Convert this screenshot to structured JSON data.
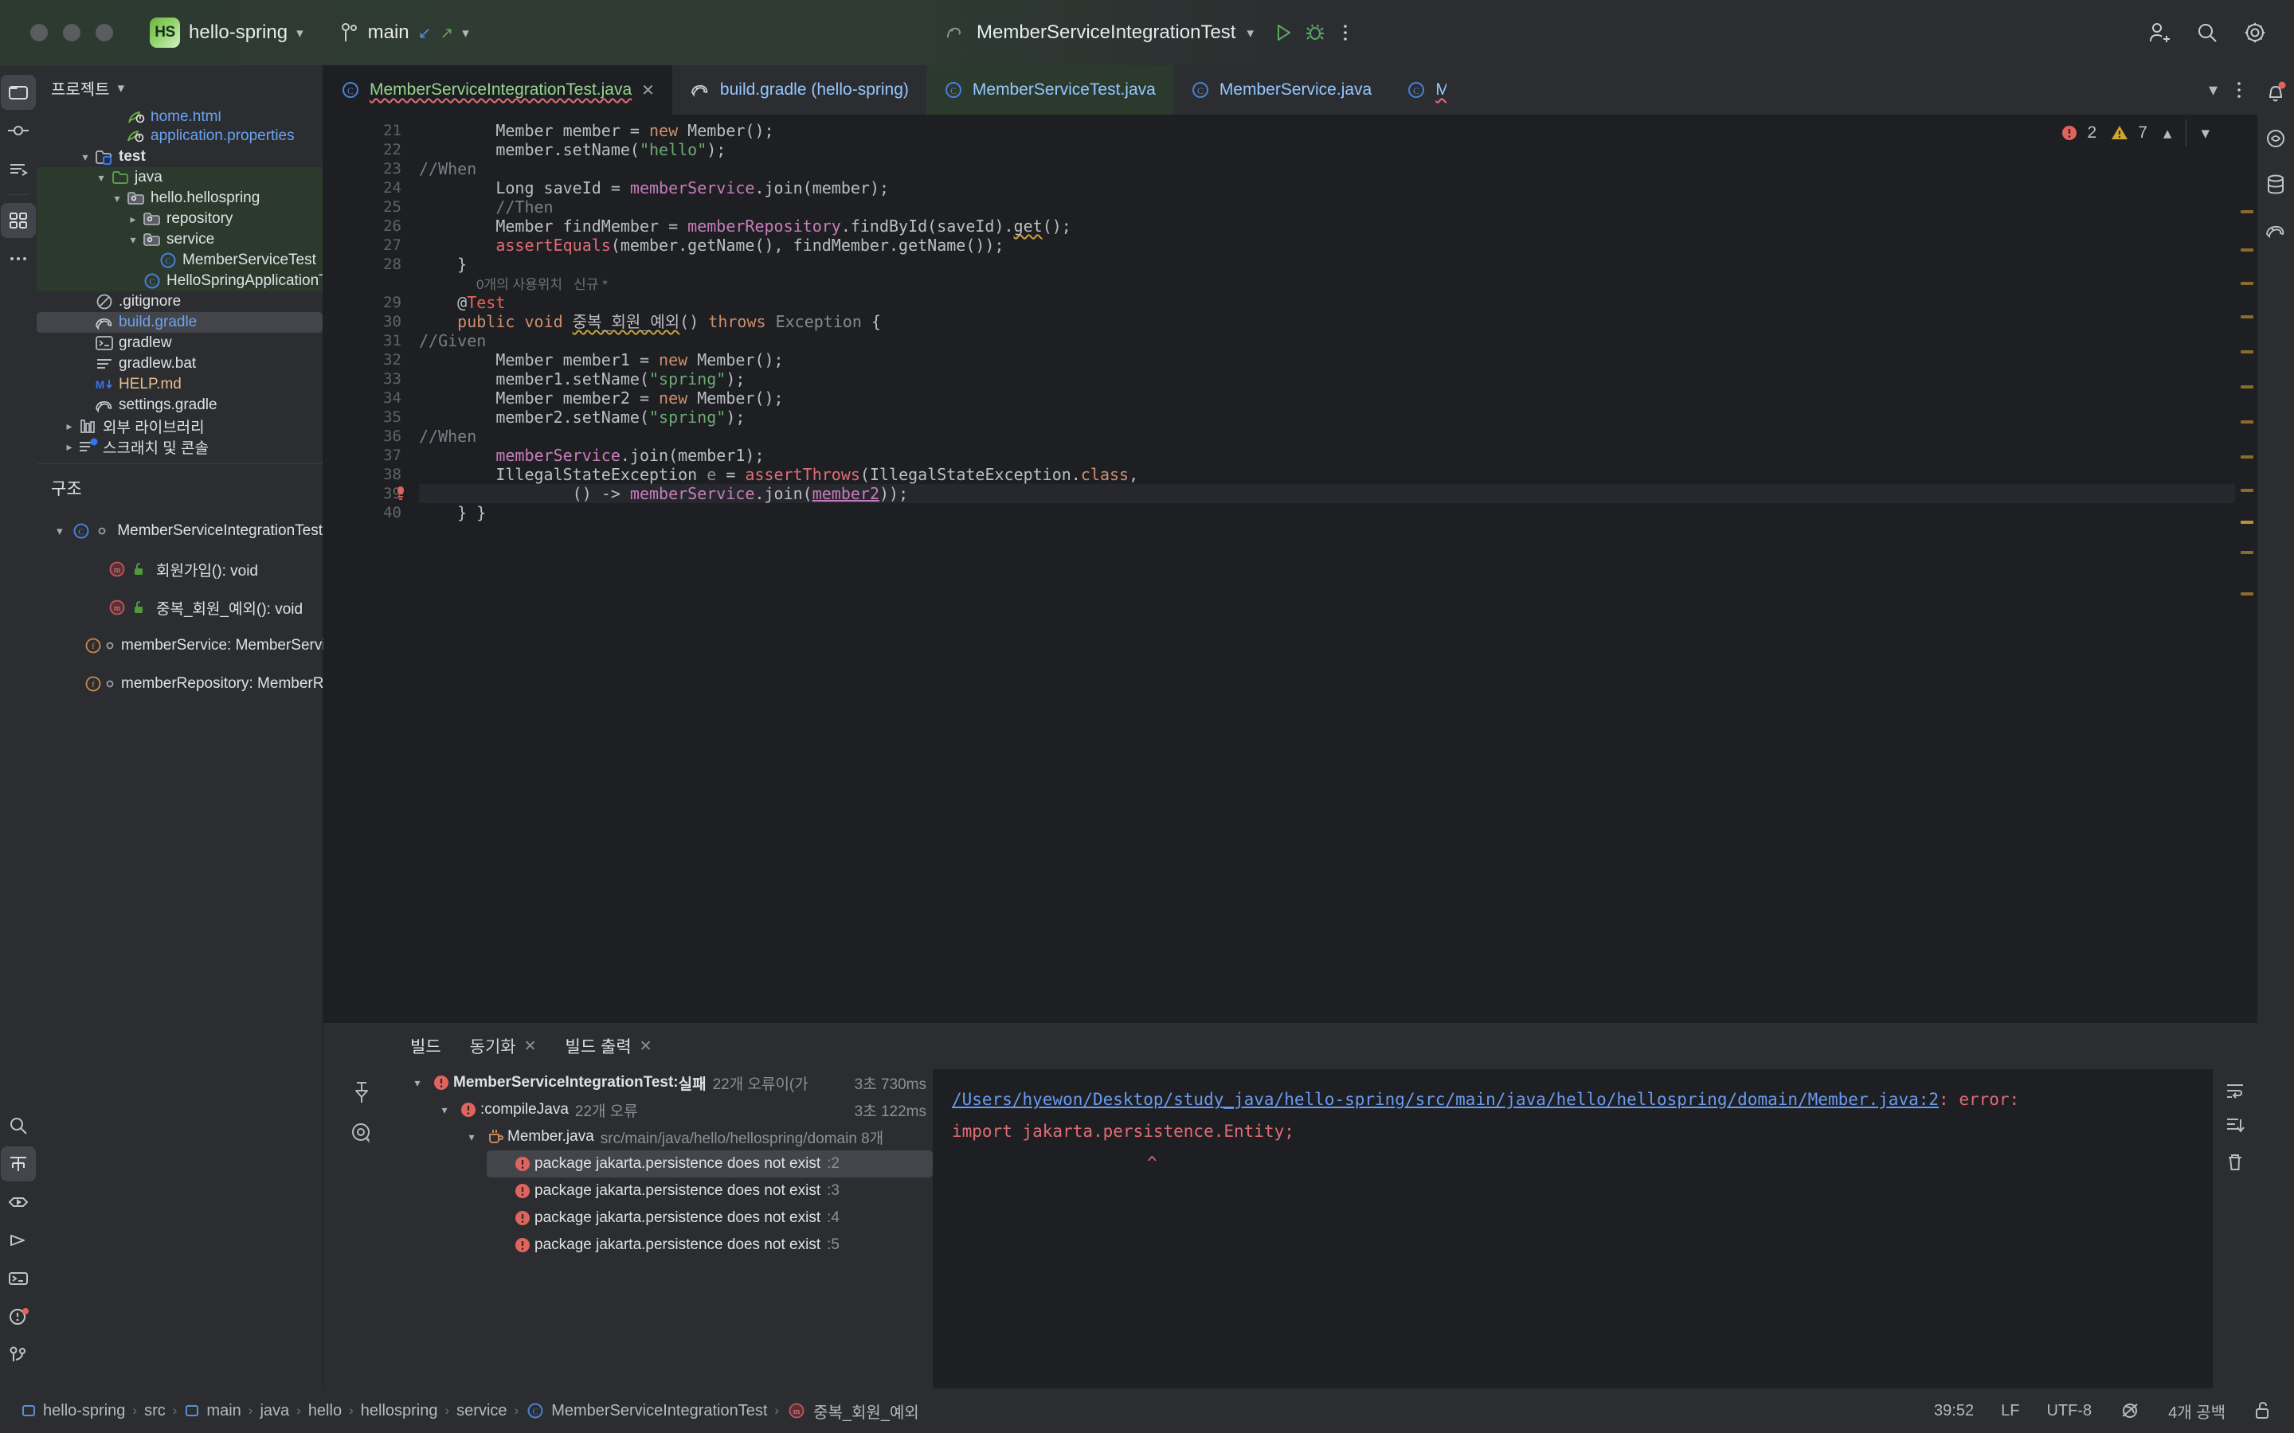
{
  "titlebar": {
    "project_badge": "HS",
    "project_name": "hello-spring",
    "branch": "main",
    "run_config": "MemberServiceIntegrationTest",
    "icons": {
      "run": "run-icon",
      "debug": "debug-icon",
      "more": "more-options-icon",
      "add_user": "add-user-icon",
      "search": "search-icon",
      "settings": "gear-icon"
    }
  },
  "left_rail": [
    {
      "name": "project-tool-icon",
      "active": true
    },
    {
      "name": "commit-tool-icon",
      "active": false
    },
    {
      "name": "pull-requests-icon",
      "active": false
    },
    {
      "name": "structure-tool-icon",
      "active": true
    },
    {
      "name": "more-tool-windows-icon",
      "active": false
    }
  ],
  "left_rail_bottom": [
    {
      "name": "search-everywhere-icon"
    },
    {
      "name": "structure-icon",
      "active": true
    },
    {
      "name": "run-tool-icon"
    },
    {
      "name": "debug-tool-icon"
    },
    {
      "name": "terminal-icon"
    },
    {
      "name": "problems-icon",
      "badge": true
    },
    {
      "name": "version-control-icon"
    }
  ],
  "right_rail": [
    {
      "name": "notifications-icon",
      "badge": true
    },
    {
      "name": "ai-assistant-icon"
    },
    {
      "name": "database-icon"
    },
    {
      "name": "gradle-icon"
    }
  ],
  "project_panel": {
    "title": "프로젝트",
    "tree": [
      {
        "indent": 4,
        "arrow": "",
        "icon": "spring-leaf-icon",
        "label": "home.html",
        "color": "blue",
        "clipped": true,
        "bg": "none"
      },
      {
        "indent": 4,
        "arrow": "",
        "icon": "spring-properties-icon",
        "label": "application.properties",
        "color": "blue",
        "bg": "none"
      },
      {
        "indent": 2,
        "arrow": "v",
        "icon": "test-folder-icon",
        "label": "test",
        "bold": true,
        "bg": "none"
      },
      {
        "indent": 3,
        "arrow": "v",
        "icon": "source-folder-icon",
        "label": "java",
        "bg": "green"
      },
      {
        "indent": 4,
        "arrow": "v",
        "icon": "package-icon",
        "label": "hello.hellospring",
        "bg": "green"
      },
      {
        "indent": 5,
        "arrow": ">",
        "icon": "package-icon",
        "label": "repository",
        "bg": "green"
      },
      {
        "indent": 5,
        "arrow": "v",
        "icon": "package-icon",
        "label": "service",
        "bg": "green"
      },
      {
        "indent": 6,
        "arrow": "",
        "icon": "class-icon",
        "label": "MemberServiceTest",
        "bg": "green"
      },
      {
        "indent": 5,
        "arrow": "",
        "icon": "class-icon",
        "label": "HelloSpringApplicationTests",
        "bg": "green"
      },
      {
        "indent": 2,
        "arrow": "",
        "icon": "gitignore-icon",
        "label": ".gitignore",
        "bg": "none"
      },
      {
        "indent": 2,
        "arrow": "",
        "icon": "gradle-icon",
        "label": "build.gradle",
        "color": "blue",
        "selected": true,
        "bg": "none"
      },
      {
        "indent": 2,
        "arrow": "",
        "icon": "shell-icon",
        "label": "gradlew",
        "bg": "none"
      },
      {
        "indent": 2,
        "arrow": "",
        "icon": "text-file-icon",
        "label": "gradlew.bat",
        "bg": "none"
      },
      {
        "indent": 2,
        "arrow": "",
        "icon": "markdown-icon",
        "label": "HELP.md",
        "color": "orange",
        "bg": "none"
      },
      {
        "indent": 2,
        "arrow": "",
        "icon": "gradle-icon",
        "label": "settings.gradle",
        "bg": "none"
      },
      {
        "indent": 1,
        "arrow": ">",
        "icon": "library-icon",
        "label": "외부 라이브러리",
        "bg": "none"
      },
      {
        "indent": 1,
        "arrow": ">",
        "icon": "scratches-icon",
        "label": "스크래치 및 콘솔",
        "bg": "none"
      }
    ]
  },
  "structure_panel": {
    "title": "구조",
    "items": [
      {
        "indent": 1,
        "arrow": "v",
        "icon": "class-icon",
        "mod": "package-private-icon",
        "label": "MemberServiceIntegrationTest"
      },
      {
        "indent": 2,
        "arrow": "",
        "icon": "method-icon",
        "mod": "public-lock-icon",
        "label": "회원가입(): void"
      },
      {
        "indent": 2,
        "arrow": "",
        "icon": "method-icon",
        "mod": "public-lock-icon",
        "label": "중복_회원_예외(): void"
      },
      {
        "indent": 2,
        "arrow": "",
        "icon": "field-icon",
        "mod": "package-private-icon",
        "label": "memberService: MemberService"
      },
      {
        "indent": 2,
        "arrow": "",
        "icon": "field-icon",
        "mod": "package-private-icon",
        "label": "memberRepository: MemberRepository"
      }
    ]
  },
  "editor_tabs": [
    {
      "label": "MemberServiceIntegrationTest.java",
      "icon": "class-icon",
      "active": true,
      "closable": true,
      "error": true
    },
    {
      "label": "build.gradle (hello-spring)",
      "icon": "gradle-icon",
      "active": false,
      "closable": false
    },
    {
      "label": "MemberServiceTest.java",
      "icon": "class-icon",
      "active": false,
      "highlight": true
    },
    {
      "label": "MemberService.java",
      "icon": "class-icon",
      "active": false
    },
    {
      "label": "M",
      "icon": "class-icon",
      "active": false,
      "truncated": true,
      "error": true
    }
  ],
  "editor_tabs_right_icons": [
    "chevron-down-icon",
    "more-options-icon"
  ],
  "inspections": {
    "errors": "2",
    "warnings": "7",
    "up": "prev-problem-icon",
    "down": "next-problem-icon",
    "collapse": "chevron-up-icon",
    "expand": "chevron-down-icon"
  },
  "code": {
    "first_line": 21,
    "lines": [
      {
        "n": 21,
        "tokens": [
          {
            "t": "        Member member = ",
            "c": "typ"
          },
          {
            "t": "new",
            "c": "kw"
          },
          {
            "t": " Member();",
            "c": "typ"
          }
        ]
      },
      {
        "n": 22,
        "tokens": [
          {
            "t": "        member.setName(",
            "c": "typ"
          },
          {
            "t": "\"hello\"",
            "c": "str"
          },
          {
            "t": ");",
            "c": "typ"
          }
        ]
      },
      {
        "n": 23,
        "tokens": [
          {
            "t": "//When",
            "c": "cmt"
          }
        ],
        "nopad": true
      },
      {
        "n": 24,
        "tokens": [
          {
            "t": "        Long saveId = ",
            "c": "typ"
          },
          {
            "t": "memberService",
            "c": "fld"
          },
          {
            "t": ".join(member);",
            "c": "typ"
          }
        ]
      },
      {
        "n": 25,
        "tokens": [
          {
            "t": "        //Then",
            "c": "cmt"
          }
        ]
      },
      {
        "n": 26,
        "tokens": [
          {
            "t": "        Member findMember = ",
            "c": "typ"
          },
          {
            "t": "memberRepository",
            "c": "fld"
          },
          {
            "t": ".findById(saveId).",
            "c": "typ"
          },
          {
            "t": "get",
            "c": "wavy"
          },
          {
            "t": "();",
            "c": "typ"
          }
        ]
      },
      {
        "n": 27,
        "tokens": [
          {
            "t": "        ",
            "c": "typ"
          },
          {
            "t": "assertEquals",
            "c": "stat"
          },
          {
            "t": "(member.getName(), findMember.getName());",
            "c": "typ"
          }
        ]
      },
      {
        "n": 28,
        "tokens": [
          {
            "t": "    }",
            "c": "typ"
          }
        ]
      },
      {
        "n": null,
        "usage": "0개의 사용위치   신규 *"
      },
      {
        "n": 29,
        "tokens": [
          {
            "t": "    @",
            "c": "typ"
          },
          {
            "t": "Test",
            "c": "annot"
          }
        ]
      },
      {
        "n": 30,
        "tokens": [
          {
            "t": "    ",
            "c": "typ"
          },
          {
            "t": "public void",
            "c": "kw"
          },
          {
            "t": " ",
            "c": "typ"
          },
          {
            "t": "중복_회원_예외",
            "c": "wavy"
          },
          {
            "t": "() ",
            "c": "typ"
          },
          {
            "t": "throws",
            "c": "kw"
          },
          {
            "t": " ",
            "c": "typ"
          },
          {
            "t": "Exception",
            "c": "dim"
          },
          {
            "t": " {",
            "c": "typ"
          }
        ]
      },
      {
        "n": 31,
        "tokens": [
          {
            "t": "//Given",
            "c": "cmt"
          }
        ],
        "nopad": true
      },
      {
        "n": 32,
        "tokens": [
          {
            "t": "        Member member1 = ",
            "c": "typ"
          },
          {
            "t": "new",
            "c": "kw"
          },
          {
            "t": " Member();",
            "c": "typ"
          }
        ]
      },
      {
        "n": 33,
        "tokens": [
          {
            "t": "        member1.setName(",
            "c": "typ"
          },
          {
            "t": "\"spring\"",
            "c": "str"
          },
          {
            "t": ");",
            "c": "typ"
          }
        ]
      },
      {
        "n": 34,
        "tokens": [
          {
            "t": "        Member member2 = ",
            "c": "typ"
          },
          {
            "t": "new",
            "c": "kw"
          },
          {
            "t": " Member();",
            "c": "typ"
          }
        ]
      },
      {
        "n": 35,
        "tokens": [
          {
            "t": "        member2.setName(",
            "c": "typ"
          },
          {
            "t": "\"spring\"",
            "c": "str"
          },
          {
            "t": ");",
            "c": "typ"
          }
        ]
      },
      {
        "n": 36,
        "tokens": [
          {
            "t": "//When",
            "c": "cmt"
          }
        ],
        "nopad": true
      },
      {
        "n": 37,
        "tokens": [
          {
            "t": "        ",
            "c": "typ"
          },
          {
            "t": "memberService",
            "c": "fld"
          },
          {
            "t": ".join(member1);",
            "c": "typ"
          }
        ]
      },
      {
        "n": 38,
        "tokens": [
          {
            "t": "        IllegalStateException ",
            "c": "typ"
          },
          {
            "t": "e",
            "c": "dim"
          },
          {
            "t": " = ",
            "c": "typ"
          },
          {
            "t": "assertThrows",
            "c": "stat"
          },
          {
            "t": "(IllegalStateException.",
            "c": "typ"
          },
          {
            "t": "class",
            "c": "kw"
          },
          {
            "t": ",",
            "c": "typ"
          }
        ]
      },
      {
        "n": 39,
        "tokens": [
          {
            "t": "                () -> ",
            "c": "typ"
          },
          {
            "t": "memberService",
            "c": "fld"
          },
          {
            "t": ".join(",
            "c": "typ"
          },
          {
            "t": "member2",
            "c": "fldu"
          },
          {
            "t": "));",
            "c": "typ"
          }
        ],
        "hl": true,
        "err_marker": true
      },
      {
        "n": 40,
        "tokens": [
          {
            "t": "    } }",
            "c": "typ"
          }
        ]
      }
    ]
  },
  "build_panel": {
    "tabs": [
      {
        "label": "빌드",
        "closable": false,
        "active": false
      },
      {
        "label": "동기화",
        "closable": true,
        "active": false
      },
      {
        "label": "빌드 출력",
        "closable": true,
        "active": true
      }
    ],
    "rail_icons": [
      "pin-icon",
      "target-icon"
    ],
    "tree": [
      {
        "indent": 0,
        "arrow": "v",
        "icon": "error-icon",
        "label": "MemberServiceIntegrationTest:",
        "bold": true,
        "suffix": " 실패",
        "detail": "22개 오류이(가",
        "time": "3초 730ms"
      },
      {
        "indent": 1,
        "arrow": "v",
        "icon": "error-icon",
        "label": ":compileJava",
        "detail": "22개 오류",
        "time": "3초 122ms"
      },
      {
        "indent": 2,
        "arrow": "v",
        "icon": "java-file-icon",
        "label": "Member.java",
        "detail": "src/main/java/hello/hellospring/domain 8개"
      },
      {
        "indent": 3,
        "arrow": "",
        "icon": "error-icon",
        "label": "package jakarta.persistence does not exist",
        "detail": ":2",
        "selected": true
      },
      {
        "indent": 3,
        "arrow": "",
        "icon": "error-icon",
        "label": "package jakarta.persistence does not exist",
        "detail": ":3"
      },
      {
        "indent": 3,
        "arrow": "",
        "icon": "error-icon",
        "label": "package jakarta.persistence does not exist",
        "detail": ":4"
      },
      {
        "indent": 3,
        "arrow": "",
        "icon": "error-icon",
        "label": "package jakarta.persistence does not exist",
        "detail": ":5"
      }
    ],
    "output": {
      "link": "/Users/hyewon/Desktop/study_java/hello-spring/src/main/java/hello/hellospring/domain/Member.java:2",
      "error_suffix": ": error:",
      "line2": "import jakarta.persistence.Entity;",
      "caret": "^"
    },
    "output_rail_icons": [
      "soft-wrap-icon",
      "scroll-to-end-icon",
      "clear-all-icon"
    ]
  },
  "status_bar": {
    "breadcrumbs": [
      {
        "label": "hello-spring",
        "icon": "module-icon"
      },
      {
        "label": "src",
        "icon": ""
      },
      {
        "label": "main",
        "icon": "module-icon"
      },
      {
        "label": "java",
        "icon": ""
      },
      {
        "label": "hello",
        "icon": ""
      },
      {
        "label": "hellospring",
        "icon": ""
      },
      {
        "label": "service",
        "icon": ""
      },
      {
        "label": "MemberServiceIntegrationTest",
        "icon": "class-icon"
      },
      {
        "label": "중복_회원_예외",
        "icon": "method-icon"
      }
    ],
    "caret": "39:52",
    "line_sep": "LF",
    "encoding": "UTF-8",
    "indent": "4개 공백",
    "icons": [
      "no-read-only-icon",
      "lock-icon"
    ]
  },
  "colors": {
    "accent_green": "#6db33f",
    "error_red": "#e06c75",
    "warn_yellow": "#c8a23b",
    "link_blue": "#6a9bf0",
    "bg_dark": "#1e1f22",
    "bg_panel": "#2b2d30",
    "selection": "#43454a",
    "test_scope_green": "#2c3a2e"
  }
}
